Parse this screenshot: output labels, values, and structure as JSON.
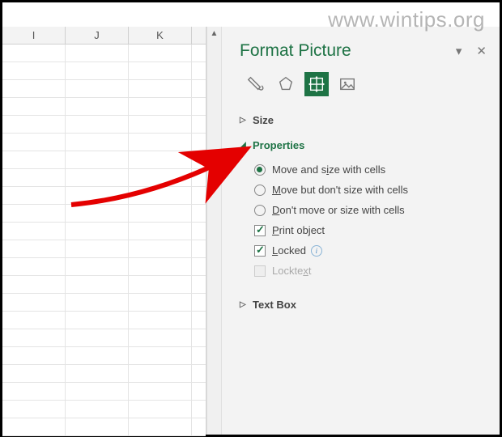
{
  "watermark": "www.wintips.org",
  "sheet": {
    "columns": [
      "I",
      "J",
      "K"
    ]
  },
  "panel": {
    "title": "Format Picture",
    "sections": {
      "size": {
        "label": "Size",
        "expanded": false
      },
      "properties": {
        "label": "Properties",
        "expanded": true,
        "radios": [
          {
            "label_pre": "Move and s",
            "accel": "i",
            "label_post": "ze with cells",
            "checked": true
          },
          {
            "label_pre": "",
            "accel": "M",
            "label_post": "ove but don't size with cells",
            "checked": false
          },
          {
            "label_pre": "",
            "accel": "D",
            "label_post": "on't move or size with cells",
            "checked": false
          }
        ],
        "checks": [
          {
            "label_pre": "",
            "accel": "P",
            "label_post": "rint object",
            "checked": true,
            "info": false,
            "disabled": false
          },
          {
            "label_pre": "",
            "accel": "L",
            "label_post": "ocked",
            "checked": true,
            "info": true,
            "disabled": false
          },
          {
            "label_pre": "Lockte",
            "accel": "x",
            "label_post": "t",
            "checked": false,
            "info": false,
            "disabled": true
          }
        ]
      },
      "textbox": {
        "label": "Text Box",
        "expanded": false
      }
    }
  }
}
